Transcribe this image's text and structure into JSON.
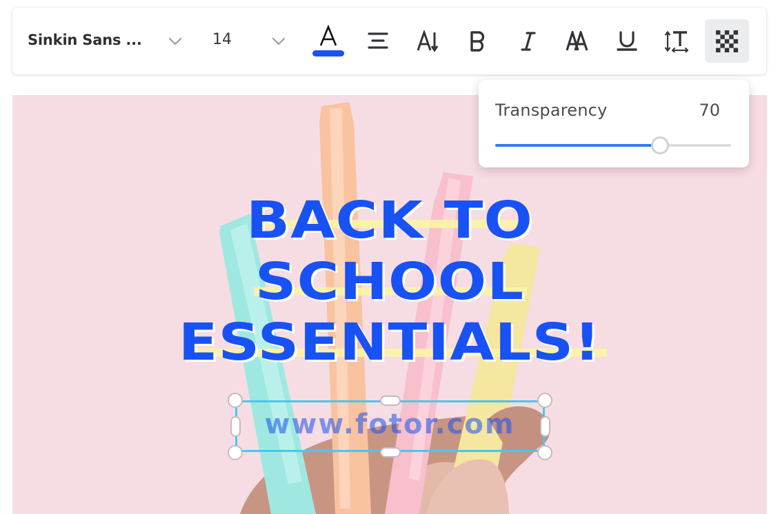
{
  "toolbar": {
    "font_family": "Sinkin Sans ...",
    "font_size": "14",
    "text_color_hex": "#1852f5",
    "tools": [
      {
        "name": "text-color",
        "icon": "text-color-icon",
        "glyph": "A"
      },
      {
        "name": "align",
        "icon": "align-center-icon"
      },
      {
        "name": "text-direction",
        "icon": "vertical-text-icon"
      },
      {
        "name": "bold",
        "icon": "bold-icon",
        "glyph": "B"
      },
      {
        "name": "italic",
        "icon": "italic-icon",
        "glyph": "I"
      },
      {
        "name": "letter-case",
        "icon": "letter-case-icon"
      },
      {
        "name": "underline",
        "icon": "underline-icon"
      },
      {
        "name": "spacing",
        "icon": "line-spacing-icon"
      },
      {
        "name": "transparency",
        "icon": "transparency-checker-icon",
        "active": true
      }
    ]
  },
  "transparency_popover": {
    "label": "Transparency",
    "value": "70",
    "slider_percent": 70
  },
  "canvas": {
    "background_hex": "#f6dde3",
    "headline_lines": [
      "BACK TO",
      "SCHOOL",
      "ESSENTIALS!"
    ],
    "headline_color_hex": "#1852f5",
    "highlight_color_hex": "#fbf4a6",
    "selected_text": "www.fotor.com",
    "selection_color_hex": "#45c8f0"
  }
}
